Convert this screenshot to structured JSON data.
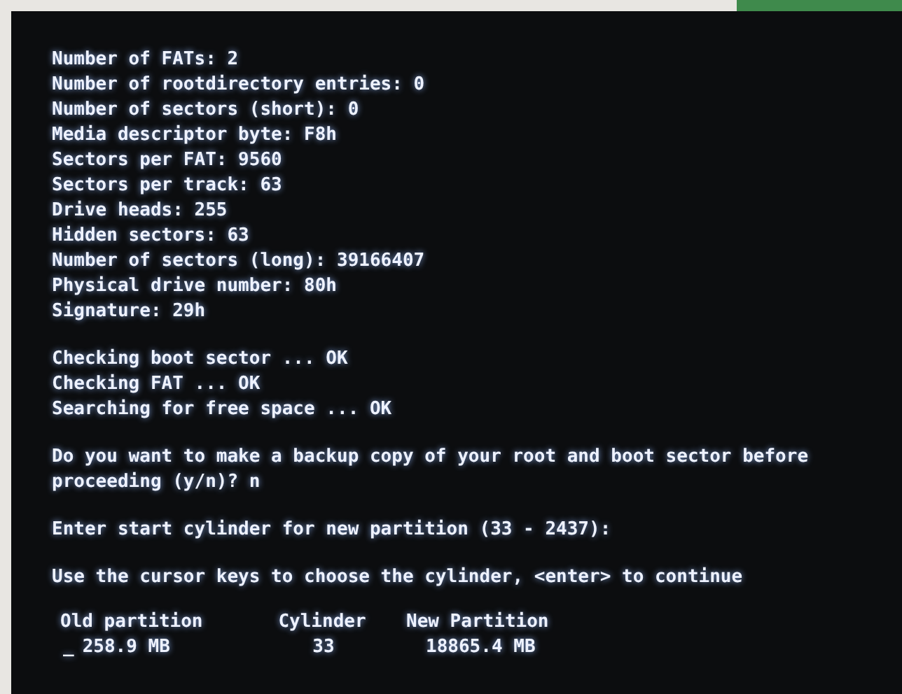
{
  "console": {
    "blocks": [
      [
        "Number of FATs: 2",
        "Number of rootdirectory entries: 0",
        "Number of sectors (short): 0",
        "Media descriptor byte: F8h",
        "Sectors per FAT: 9560",
        "Sectors per track: 63",
        "Drive heads: 255",
        "Hidden sectors: 63",
        "Number of sectors (long): 39166407",
        "Physical drive number: 80h",
        "Signature: 29h"
      ],
      [
        "Checking boot sector ... OK",
        "Checking FAT ... OK",
        "Searching for free space ... OK"
      ],
      [
        "Do you want to make a backup copy of your root and boot sector before",
        "proceeding (y/n)? n"
      ],
      [
        "Enter start cylinder for new partition (33 - 2437):"
      ],
      [
        "Use the cursor keys to choose the cylinder, <enter> to continue"
      ]
    ],
    "partition_table": {
      "cursor": "_",
      "columns": [
        {
          "header": "Old partition",
          "value": "258.9 MB"
        },
        {
          "header": "Cylinder",
          "value": "33"
        },
        {
          "header": "New Partition",
          "value": "18865.4 MB"
        }
      ]
    }
  }
}
